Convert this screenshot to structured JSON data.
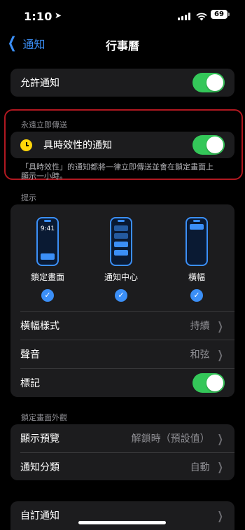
{
  "status": {
    "time": "1:10",
    "battery": "69"
  },
  "nav": {
    "back_label": "通知",
    "title": "行事曆"
  },
  "allow": {
    "label": "允許通知",
    "on": true
  },
  "always": {
    "header": "永遠立即傳送",
    "label": "具時效性的通知",
    "on": true,
    "footer_line1": "「具時效性」的通知都將一律立即傳送並會在鎖定畫面上",
    "footer_line2": "顯示一小時。"
  },
  "alerts": {
    "header": "提示",
    "lock_time": "9:41",
    "styles": [
      {
        "label": "鎖定畫面",
        "checked": true
      },
      {
        "label": "通知中心",
        "checked": true
      },
      {
        "label": "橫幅",
        "checked": true
      }
    ],
    "banner_style_label": "橫幅樣式",
    "banner_style_value": "持續",
    "sound_label": "聲音",
    "sound_value": "和弦",
    "badge_label": "標記",
    "badge_on": true
  },
  "lock_appearance": {
    "header": "鎖定畫面外觀",
    "preview_label": "顯示預覽",
    "preview_value": "解鎖時（預設值）",
    "grouping_label": "通知分類",
    "grouping_value": "自動"
  },
  "custom": {
    "label": "自訂通知"
  },
  "colors": {
    "accent": "#3b8ff7",
    "toggle_on": "#34c759",
    "highlight": "#b01820"
  }
}
